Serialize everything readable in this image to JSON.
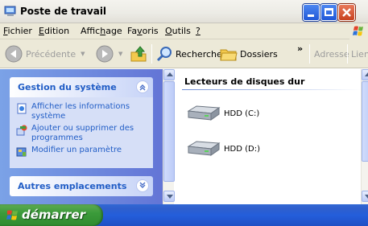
{
  "window": {
    "title": "Poste de travail"
  },
  "menu": [
    {
      "pre": "",
      "u": "F",
      "post": "ichier"
    },
    {
      "pre": "",
      "u": "E",
      "post": "dition"
    },
    {
      "pre": "Affic",
      "u": "h",
      "post": "age"
    },
    {
      "pre": "Fa",
      "u": "v",
      "post": "oris"
    },
    {
      "pre": "",
      "u": "O",
      "post": "utils"
    },
    {
      "pre": "",
      "u": "?",
      "post": ""
    }
  ],
  "toolbar": {
    "back_label": "Précédente",
    "search_label": "Rechercher",
    "folders_label": "Dossiers",
    "overflow": "»",
    "address_label": "Adresse",
    "links_label": "Liens"
  },
  "taskpane": {
    "system_tasks": {
      "title": "Gestion du système",
      "items": [
        {
          "label": "Afficher les informations système",
          "icon": "system-info-icon"
        },
        {
          "label": "Ajouter ou supprimer des programmes",
          "icon": "add-remove-programs-icon"
        },
        {
          "label": "Modifier un paramètre",
          "icon": "control-panel-icon"
        }
      ]
    },
    "other_places": {
      "title": "Autres emplacements"
    }
  },
  "content": {
    "section_title": "Lecteurs de disques dur",
    "drives": [
      {
        "label": "HDD (C:)",
        "icon": "hard-drive-icon"
      },
      {
        "label": "HDD (D:)",
        "icon": "hard-drive-icon"
      }
    ]
  },
  "taskbar": {
    "start_label": "démarrer"
  },
  "colors": {
    "taskpane_gradient_start": "#7ba2e7",
    "taskpane_gradient_end": "#6375d6",
    "link_blue": "#215dc6",
    "taskbar_blue": "#245edb",
    "start_green": "#3b9b3a"
  }
}
